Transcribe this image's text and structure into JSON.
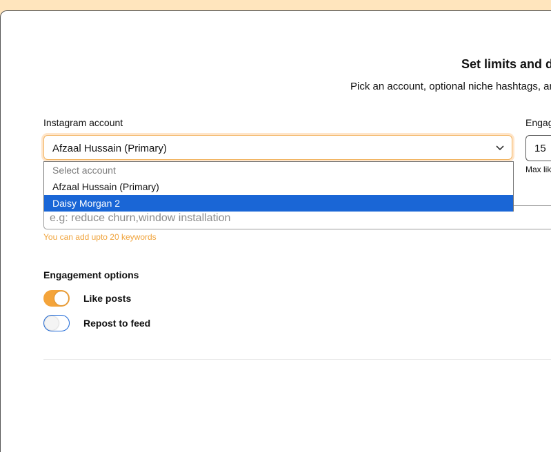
{
  "page": {
    "title": "Set limits and de",
    "subtitle": "Pick an account, optional niche hashtags, and h"
  },
  "account": {
    "label": "Instagram account",
    "selected": "Afzaal Hussain (Primary)",
    "options": [
      {
        "label": "Select account",
        "placeholder": true
      },
      {
        "label": "Afzaal Hussain (Primary)"
      },
      {
        "label": "Daisy Morgan 2",
        "highlighted": true
      }
    ]
  },
  "engagement_limit": {
    "label": "Engag",
    "value": "15",
    "hint": "Max lik"
  },
  "keywords": {
    "placeholder": "e.g: reduce churn,window installation",
    "hint": "You can add upto 20 keywords"
  },
  "engagement_options": {
    "title": "Engagement options",
    "items": [
      {
        "label": "Like posts",
        "on": true
      },
      {
        "label": "Repost to feed",
        "on": false
      }
    ]
  },
  "colors": {
    "accent": "#f4a43a",
    "highlight": "#1a66d6",
    "hint": "#f0a33b",
    "background": "#ffe5bd"
  }
}
